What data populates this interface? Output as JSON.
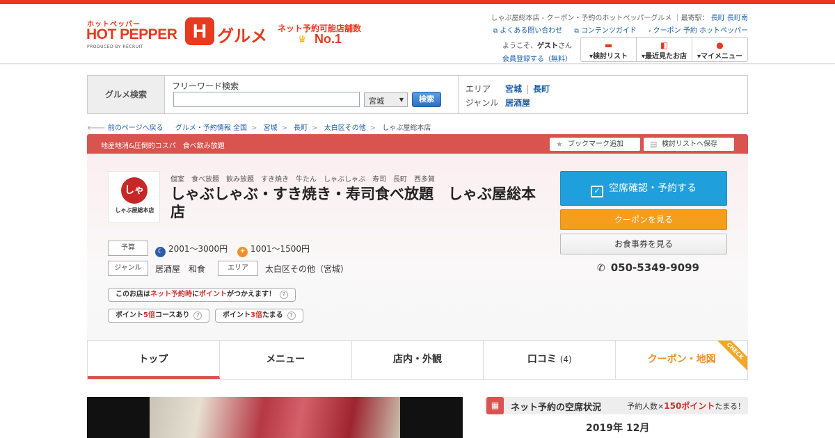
{
  "colors": {
    "brand": "#e73a1e",
    "link": "#1a5fa8",
    "band": "#d9534f",
    "reserve": "#1fa0dc",
    "coupon": "#f59d1c"
  },
  "header": {
    "logo_small": "ホットペッパー",
    "logo_main": "HOT PEPPER",
    "logo_sub": "PRODUCED BY RECRUIT",
    "logo_h": "H",
    "logo_gourmet": "グルメ",
    "no1_top": "ネット予約可能店舗数",
    "no1_main": "No.1",
    "crumb_prefix": "しゃぶ屋総本店 - クーポン・予約のホットペッパーグルメ ｜最寄駅：",
    "station1": "長町",
    "station2": "長町南",
    "links": [
      "よくある問い合わせ",
      "コンテンツガイド",
      "クーポン 予約 ホットペッパー"
    ],
    "welcome_prefix": "ようこそ、",
    "welcome_name": "ゲスト",
    "welcome_suffix": "さん",
    "register": "会員登録する（無料）",
    "btns": [
      "検討リスト",
      "最近見たお店",
      "マイメニュー"
    ]
  },
  "search": {
    "label": "グルメ検索",
    "freeword_label": "フリーワード検索",
    "freeword_value": "",
    "pref": "宮城",
    "button": "検索",
    "area_label": "エリア",
    "area1": "宮城",
    "area2": "長町",
    "genre_label": "ジャンル",
    "genre": "居酒屋"
  },
  "breadcrumb": {
    "back": "前のページへ戻る",
    "items": [
      "グルメ・予約情報 全国",
      "宮城",
      "長町",
      "太白区その他"
    ],
    "current": "しゃぶ屋総本店"
  },
  "band": {
    "text": "地産地消&圧倒的コスパ　食べ飲み放題",
    "bookmark": "ブックマーク追加",
    "save": "検討リストへ保存"
  },
  "shop": {
    "logo_text": "しゃぶ屋",
    "logo_caption": "しゃぶ屋総本店",
    "tags": [
      "個室",
      "食べ放題",
      "飲み放題",
      "すき焼き",
      "牛たん",
      "しゃぶしゃぶ",
      "寿司",
      "長町",
      "西多賀"
    ],
    "name": "しゃぶしゃぶ・すき焼き・寿司食べ放題　しゃぶ屋総本店",
    "budget_label": "予算",
    "budget_dinner": "2001～3000円",
    "budget_lunch": "1001～1500円",
    "genre_label": "ジャンル",
    "genre": "居酒屋　和食",
    "area_label": "エリア",
    "area": "太白区その他（宮城）",
    "pill1_a": "このお店は",
    "pill1_b": "ネット予約時",
    "pill1_c": "に",
    "pill1_d": "ポイント",
    "pill1_e": "がつかえます！",
    "pill2_a": "ポイント",
    "pill2_b": "5倍",
    "pill2_c": "コースあり",
    "pill3_a": "ポイント",
    "pill3_b": "3倍",
    "pill3_c": "たまる",
    "reserve": "空席確認・予約する",
    "coupon": "クーポンを見る",
    "ticket": "お食事券を見る",
    "phone": "050-5349-9099"
  },
  "tabs": {
    "top": "トップ",
    "menu": "メニュー",
    "interior": "店内・外観",
    "reviews": "口コミ",
    "reviews_count": "(4)",
    "coupon_map": "クーポン・地図",
    "check": "CHECK"
  },
  "availability": {
    "title": "ネット予約の空席状況",
    "pts_a": "予約人数×",
    "pts_b": "150ポイント",
    "pts_c": "たまる！",
    "month": "2019年 12月"
  }
}
